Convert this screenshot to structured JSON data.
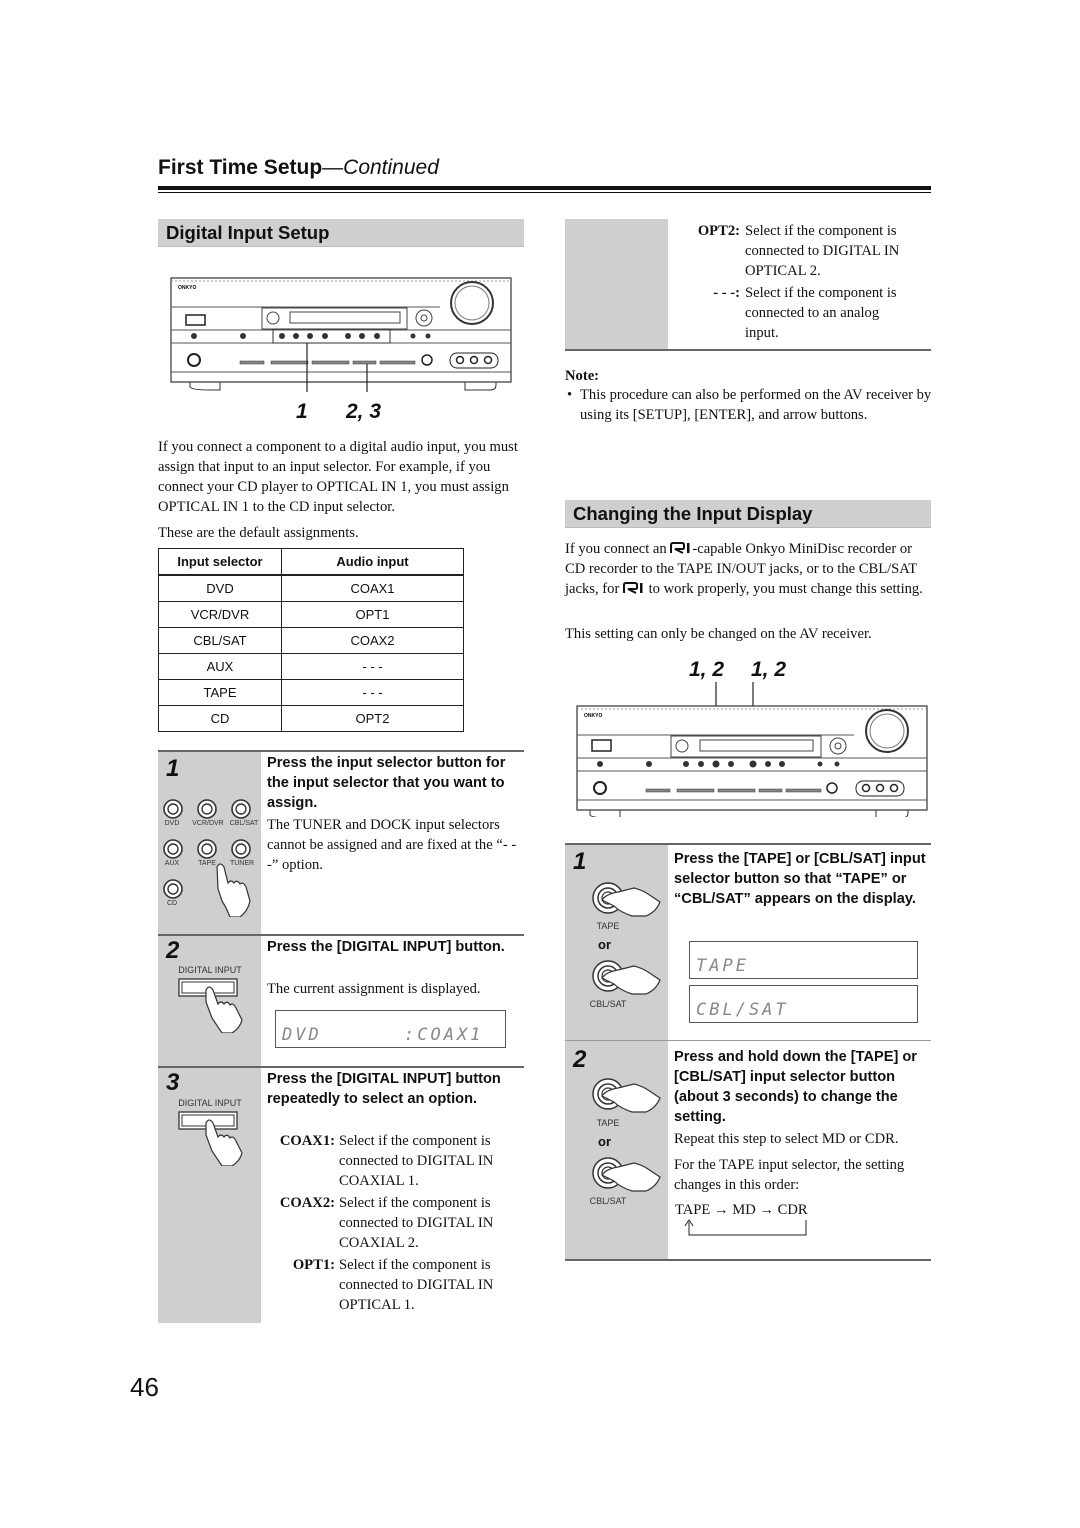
{
  "header": {
    "title": "First Time Setup",
    "continued": "—Continued"
  },
  "page_number": "46",
  "left": {
    "section_title": "Digital Input Setup",
    "device_image": {
      "brand": "ONKYO",
      "callouts": [
        "1",
        "2, 3"
      ]
    },
    "intro": "If you connect a component to a digital audio input, you must assign that input to an input selector. For example, if you connect your CD player to OPTICAL IN 1, you must assign OPTICAL IN 1 to the CD input selector.",
    "defaults_intro": "These are the default assignments.",
    "table": {
      "headers": [
        "Input selector",
        "Audio input"
      ],
      "rows": [
        [
          "DVD",
          "COAX1"
        ],
        [
          "VCR/DVR",
          "OPT1"
        ],
        [
          "CBL/SAT",
          "COAX2"
        ],
        [
          "AUX",
          "- - -"
        ],
        [
          "TAPE",
          "- - -"
        ],
        [
          "CD",
          "OPT2"
        ]
      ]
    },
    "steps": [
      {
        "num": "1",
        "heading": "Press the input selector button for the input selector that you want to assign.",
        "body": "The TUNER and DOCK input selectors cannot be assigned and are fixed at the “- - -” option.",
        "buttons": [
          "DVD",
          "VCR/DVR",
          "CBL/SAT",
          "AUX",
          "TAPE",
          "TUNER",
          "CD"
        ]
      },
      {
        "num": "2",
        "heading": "Press the [DIGITAL INPUT] button.",
        "body": "The current assignment is displayed.",
        "button_label": "DIGITAL INPUT",
        "display_left": "DVD",
        "display_right": ":COAX1"
      },
      {
        "num": "3",
        "heading": "Press the [DIGITAL INPUT] button repeatedly to select an option.",
        "button_label": "DIGITAL INPUT",
        "options": [
          {
            "key": "COAX1",
            "desc": [
              "Select if the component is",
              "connected to DIGITAL IN",
              "COAXIAL 1."
            ]
          },
          {
            "key": "COAX2",
            "desc": [
              "Select if the component is",
              "connected to DIGITAL IN",
              "COAXIAL 2."
            ]
          },
          {
            "key": "OPT1",
            "desc": [
              "Select if the component is",
              "connected to DIGITAL IN",
              "OPTICAL 1."
            ]
          }
        ]
      }
    ]
  },
  "right": {
    "continued_options": [
      {
        "key": "OPT2",
        "desc": [
          "Select if the component is",
          "connected to DIGITAL IN",
          "OPTICAL 2."
        ]
      },
      {
        "key": "- - -",
        "desc": [
          "Select if the component is",
          "connected to an analog",
          "input."
        ]
      }
    ],
    "note_title": "Note:",
    "note_bullet": "•",
    "note_text": "This procedure can also be performed on the AV receiver by using its [SETUP], [ENTER], and arrow buttons.",
    "section_title": "Changing the Input Display",
    "intro_parts": [
      "If you connect an ",
      "-capable Onkyo MiniDisc recorder or CD recorder to the TAPE IN/OUT jacks, or to the CBL/SAT jacks, for ",
      " to work properly, you must change this setting."
    ],
    "intro2": "This setting can only be changed on the AV receiver.",
    "device_image": {
      "brand": "ONKYO",
      "callouts": [
        "1, 2",
        "1, 2"
      ]
    },
    "steps": [
      {
        "num": "1",
        "heading": "Press the [TAPE] or [CBL/SAT] input selector button so that “TAPE” or “CBL/SAT” appears on the display.",
        "label_a": "TAPE",
        "or": "or",
        "label_b": "CBL/SAT",
        "displays": [
          "TAPE",
          "CBL/SAT"
        ]
      },
      {
        "num": "2",
        "heading": "Press and hold down the [TAPE] or [CBL/SAT] input selector button (about 3 seconds) to change the setting.",
        "body1": "Repeat this step to select MD or CDR.",
        "body2": "For the TAPE input selector, the setting changes in this order:",
        "label_a": "TAPE",
        "or": "or",
        "label_b": "CBL/SAT",
        "cycle": [
          "TAPE",
          "MD",
          "CDR"
        ],
        "arrow": "→"
      }
    ]
  }
}
